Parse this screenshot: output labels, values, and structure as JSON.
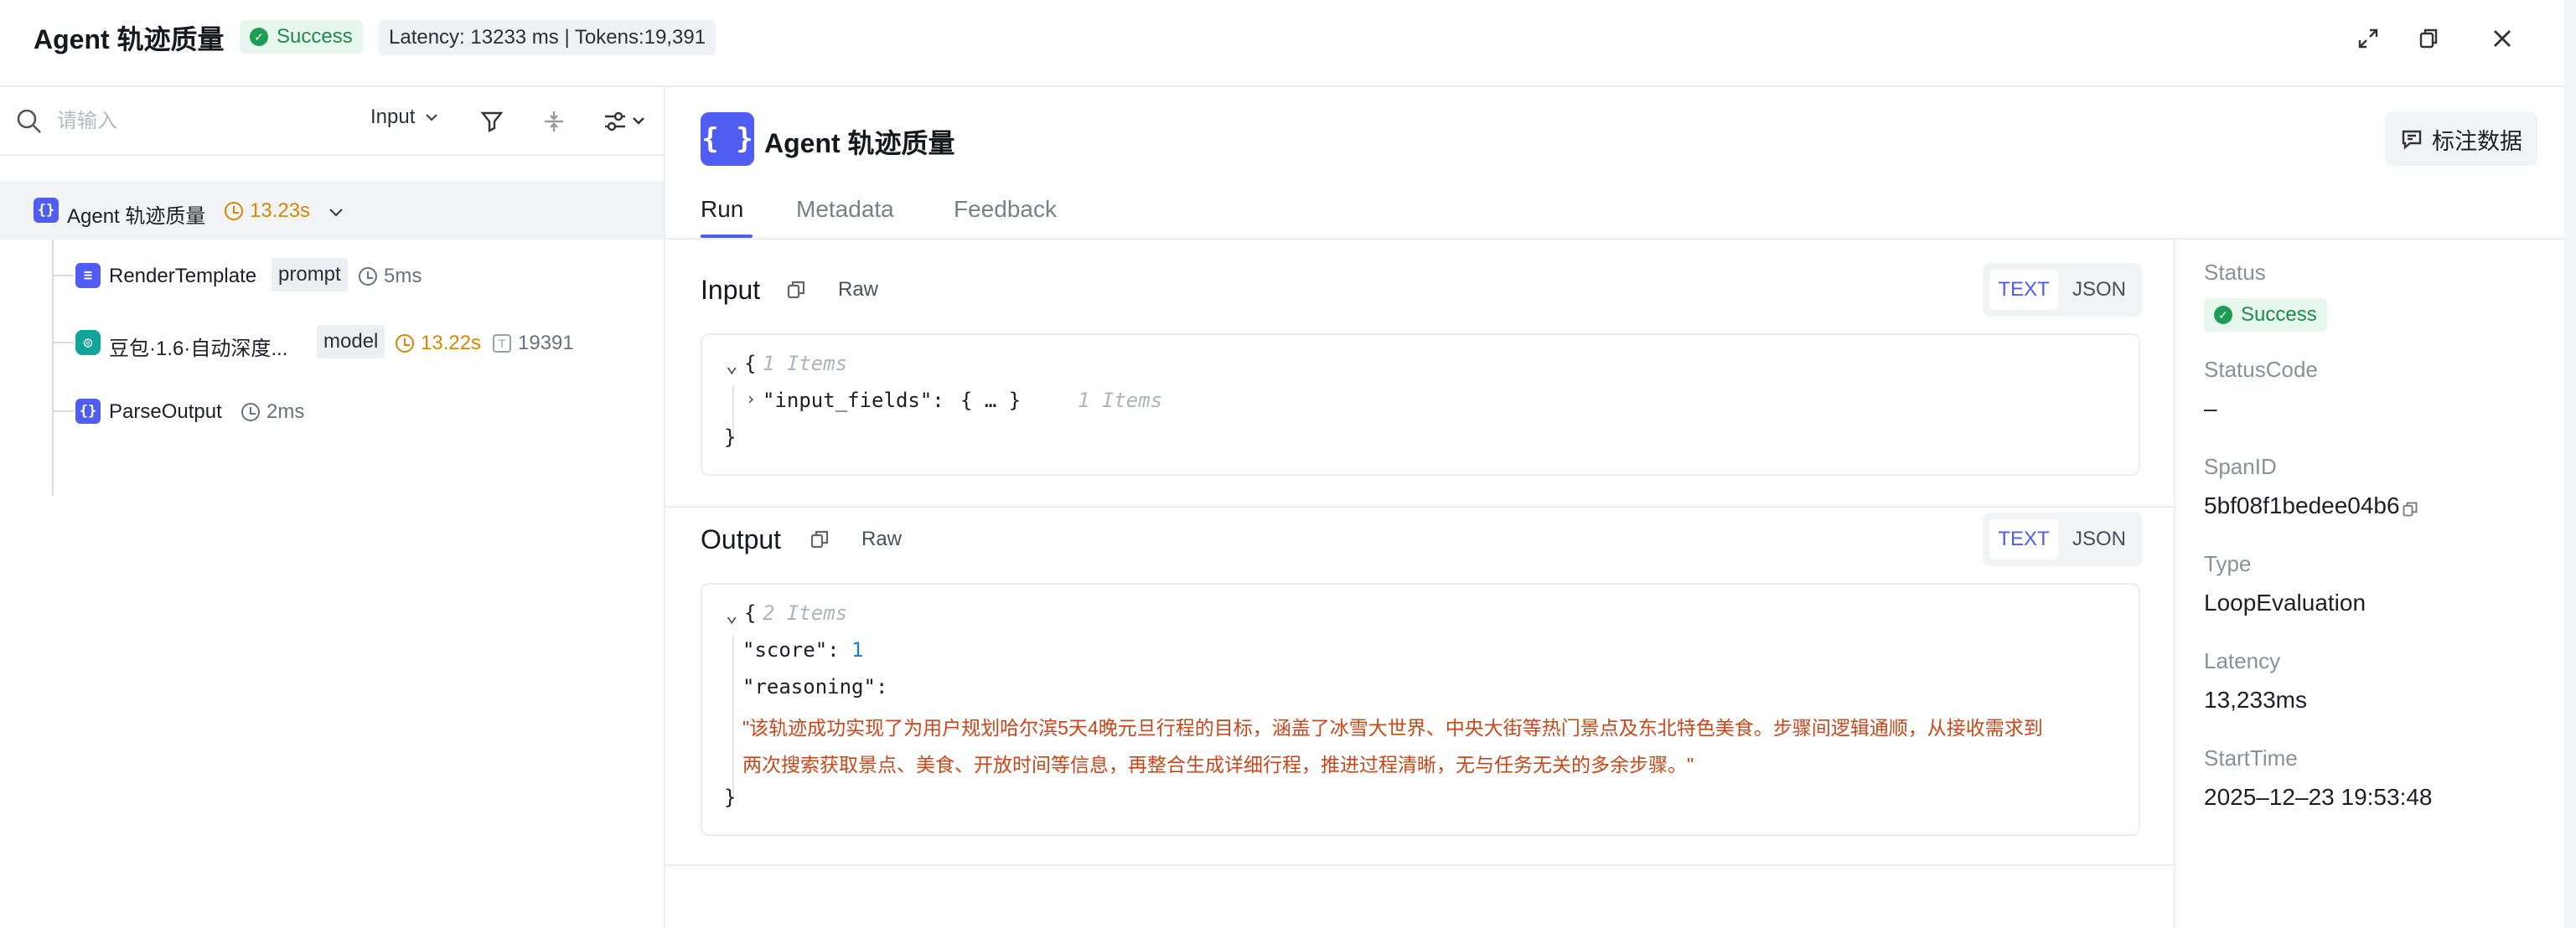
{
  "header": {
    "title": "Agent 轨迹质量",
    "status": "Success",
    "latency_text": "Latency: 13233 ms | Tokens:19,391"
  },
  "left": {
    "search_placeholder": "请输入",
    "filter_select": "Input",
    "tree": {
      "root": {
        "label": "Agent 轨迹质量",
        "time": "13.23s"
      },
      "children": [
        {
          "label": "RenderTemplate",
          "tag": "prompt",
          "time": "5ms"
        },
        {
          "label": "豆包·1.6·自动深度...",
          "tag": "model",
          "time": "13.22s",
          "tokens": "19391"
        },
        {
          "label": "ParseOutput",
          "time": "2ms"
        }
      ]
    }
  },
  "main": {
    "icon_glyph": "{ }",
    "title": "Agent 轨迹质量",
    "annotate_button": "标注数据",
    "tabs": [
      "Run",
      "Metadata",
      "Feedback"
    ],
    "input": {
      "title": "Input",
      "raw": "Raw",
      "mode_text": "TEXT",
      "mode_json": "JSON",
      "lines": {
        "open": "{",
        "open_hint": "1 Items",
        "field_key": "\"input_fields\":",
        "field_collapsed": "{ … }",
        "field_hint": "1 Items",
        "close": "}"
      }
    },
    "output": {
      "title": "Output",
      "raw": "Raw",
      "mode_text": "TEXT",
      "mode_json": "JSON",
      "lines": {
        "open": "{",
        "open_hint": "2 Items",
        "score_key": "\"score\":",
        "score_value": "1",
        "reasoning_key": "\"reasoning\":",
        "reasoning_line1": "\"该轨迹成功实现了为用户规划哈尔滨5天4晚元旦行程的目标，涵盖了冰雪大世界、中央大街等热门景点及东北特色美食。步骤间逻辑通顺，从接收需求到",
        "reasoning_line2": "两次搜索获取景点、美食、开放时间等信息，再整合生成详细行程，推进过程清晰，无与任务无关的多余步骤。\"",
        "close": "}"
      }
    }
  },
  "info": {
    "status_label": "Status",
    "status_value": "Success",
    "statuscode_label": "StatusCode",
    "statuscode_value": "–",
    "spanid_label": "SpanID",
    "spanid_value": "5bf08f1bedee04b6",
    "type_label": "Type",
    "type_value": "LoopEvaluation",
    "latency_label": "Latency",
    "latency_value": "13,233ms",
    "starttime_label": "StartTime",
    "starttime_value": "2025–12–23 19:53:48"
  },
  "colors": {
    "accent": "#4f5df0",
    "success": "#1f9d55",
    "orange": "#d48806",
    "string": "#c8471a",
    "model_icon": "#12a39a"
  }
}
